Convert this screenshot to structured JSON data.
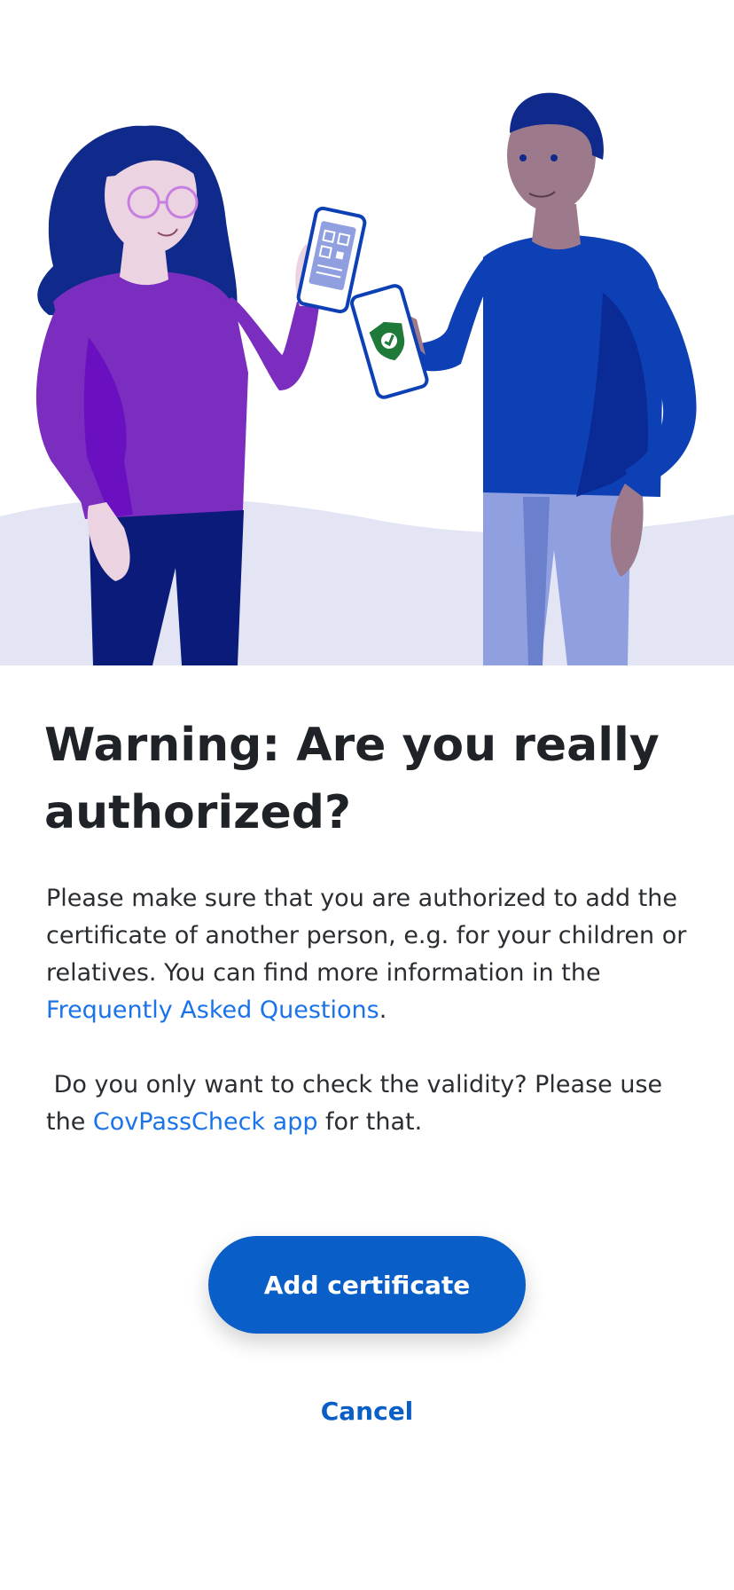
{
  "hero": {
    "illustration": "two-people-sharing-certificate-illustration",
    "colors": {
      "ground": "#e3e5f4",
      "woman_shirt": "#7a2dbf",
      "man_shirt": "#0d3fb5",
      "pants_dark": "#0b1b7a",
      "pants_light": "#8f9fdf",
      "shield": "#1f7a3a"
    }
  },
  "dialog": {
    "title": "Warning: Are you really authorized?",
    "paragraph1": {
      "text": "Please make sure that you are authorized to add the certificate of another person, e.g. for your children or relatives. You can find more information in the ",
      "link": "Frequently Asked Questions",
      "suffix": "."
    },
    "paragraph2": {
      "text": " Do you only want to check the validity? Please use the ",
      "link": "CovPassCheck app",
      "suffix": " for that."
    },
    "primary_button": "Add certificate",
    "secondary_button": "Cancel"
  },
  "colors": {
    "accent": "#0a5ec7",
    "link": "#1a73e8",
    "text": "#1f2328"
  }
}
